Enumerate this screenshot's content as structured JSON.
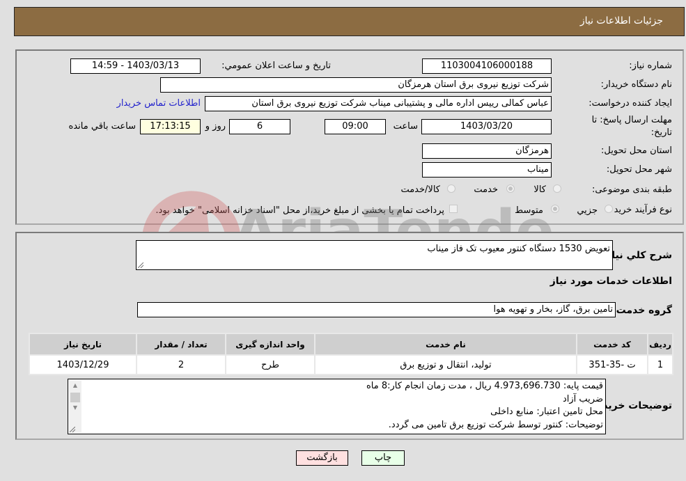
{
  "header": {
    "title": "جزئیات اطلاعات نیاز"
  },
  "details": {
    "need_number_label": "شماره نیاز:",
    "need_number": "1103004106000188",
    "announce_label": "تاریخ و ساعت اعلان عمومي:",
    "announce_value": "1403/03/13 - 14:59",
    "buyer_org_label": "نام دستگاه خریدار:",
    "buyer_org": "شرکت توزیع نیروی برق استان هرمزگان",
    "creator_label": "ایجاد کننده درخواست:",
    "creator": "عباس کمالی رییس اداره مالی و پشتیبانی میناب شرکت توزیع نیروی برق استان",
    "contact_link": "اطلاعات تماس خریدار",
    "deadline_label_line1": "مهلت ارسال پاسخ: تا",
    "deadline_label_line2": "تاریخ:",
    "deadline_date": "1403/03/20",
    "time_label": "ساعت",
    "deadline_time": "09:00",
    "days_value": "6",
    "days_label": "روز و",
    "remaining_time": "17:13:15",
    "remaining_label": "ساعت باقي مانده",
    "province_label": "استان محل تحویل:",
    "province": "هرمزگان",
    "city_label": "شهر محل تحویل:",
    "city": "میناب",
    "category_label": "طبقه بندی موضوعی:",
    "category_options": [
      {
        "label": "کالا",
        "checked": false
      },
      {
        "label": "خدمت",
        "checked": true
      },
      {
        "label": "کالا/خدمت",
        "checked": false
      }
    ],
    "process_label": "نوع فرآیند خرید :",
    "process_options": [
      {
        "label": "جزیي",
        "checked": false
      },
      {
        "label": "متوسط",
        "checked": true
      }
    ],
    "treasury_note": "پرداخت تمام یا بخشی از مبلغ خرید،از محل \"اسناد خزانه اسلامی\" خواهد بود.",
    "treasury_checked": false
  },
  "watermark": {
    "text": "AriaTender.neT"
  },
  "services": {
    "summary_label": "شرح کلي نیاز:",
    "summary": "تعویض 1530 دستگاه کنتور معیوب تک فاز میناب",
    "section_title": "اطلاعات خدمات مورد نیاز",
    "group_label": "گروه خدمت:",
    "group": "تامین برق، گاز، بخار و تهویه هوا",
    "table": {
      "headers": [
        "ردیف",
        "کد خدمت",
        "نام خدمت",
        "واحد اندازه گیری",
        "تعداد / مقدار",
        "تاریخ نیاز"
      ],
      "rows": [
        [
          "1",
          "ت -35-351",
          "تولید، انتقال و توزیع برق",
          "طرح",
          "2",
          "1403/12/29"
        ]
      ]
    },
    "buyer_notes_label": "توضیحات خریدار:",
    "buyer_notes": [
      "قیمت پایه: 4.973,696.730 ریال ، مدت زمان انجام کار:8 ماه",
      "ضریب آزاد",
      "محل تامین اعتبار: منابع داخلی",
      "توضیحات: کنتور توسط شرکت توزیع برق تامین می گردد."
    ]
  },
  "buttons": {
    "print": "چاپ",
    "back": "بازگشت"
  }
}
